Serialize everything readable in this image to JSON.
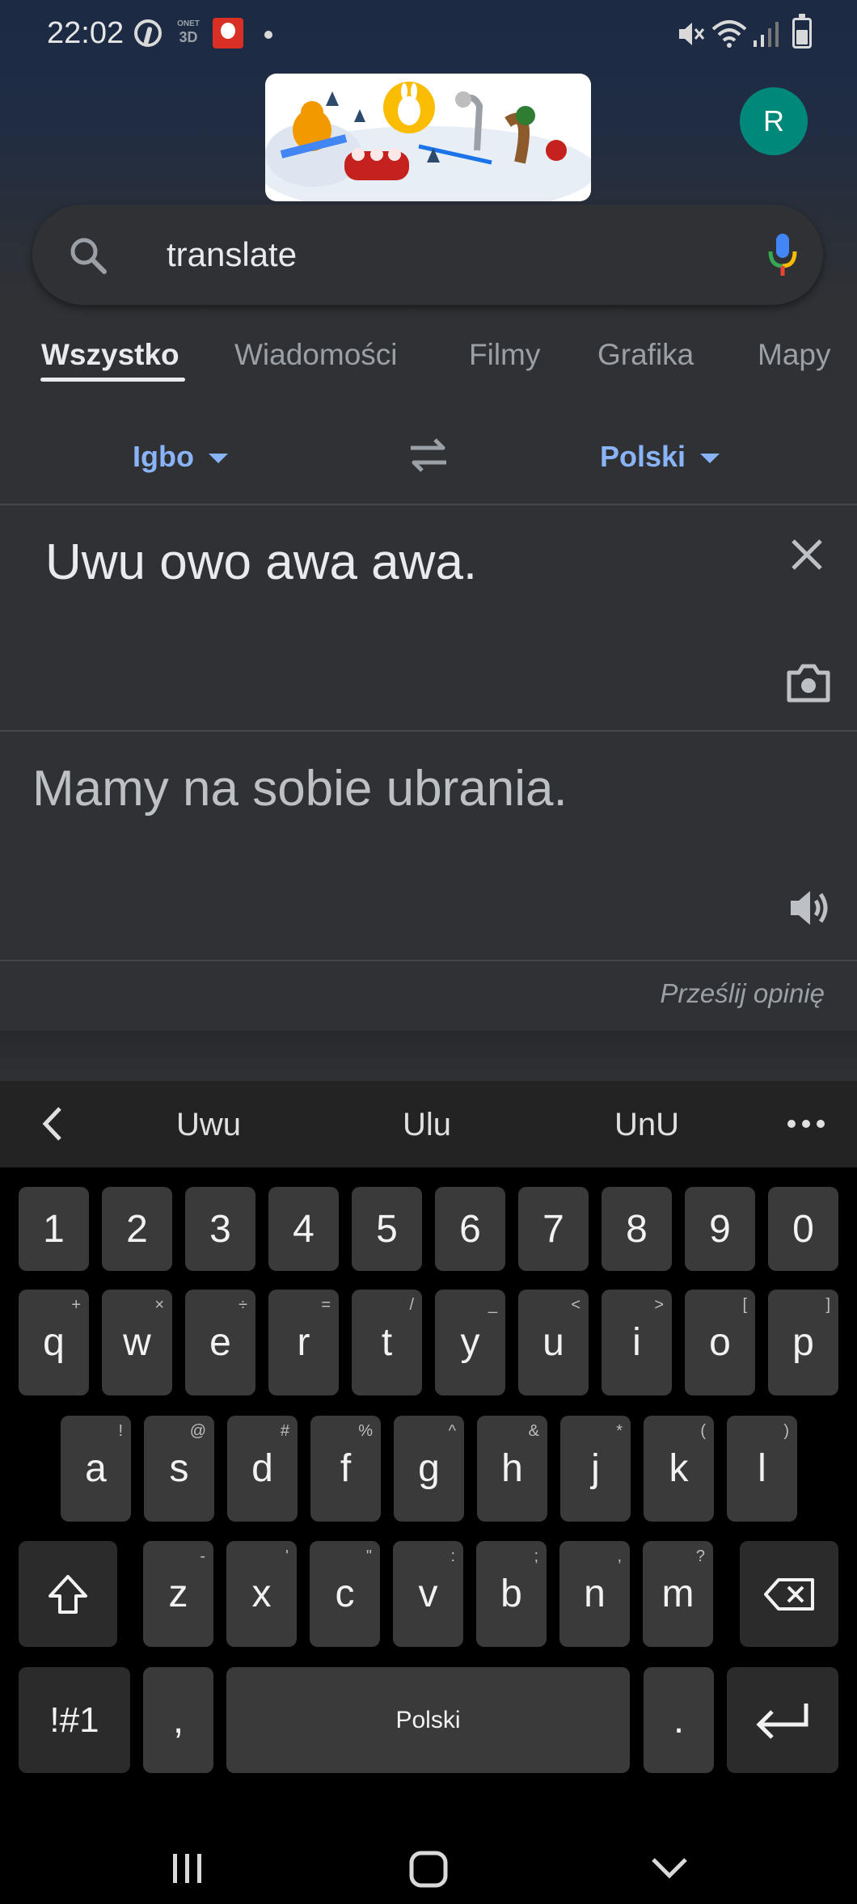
{
  "status_bar": {
    "time": "22:02",
    "onet_top": "ONET",
    "onet_bottom": "3D"
  },
  "avatar": {
    "initial": "R"
  },
  "search": {
    "query": "translate"
  },
  "tabs": [
    "Wszystko",
    "Wiadomości",
    "Filmy",
    "Grafika",
    "Mapy"
  ],
  "translate": {
    "source_language": "Igbo",
    "target_language": "Polski",
    "source_text": "Uwu owo awa awa.",
    "translation_text": "Mamy na sobie ubrania.",
    "feedback_label": "Prześlij opinię"
  },
  "keyboard": {
    "suggestions": [
      "Uwu",
      "Ulu",
      "UnU"
    ],
    "row_numbers": [
      "1",
      "2",
      "3",
      "4",
      "5",
      "6",
      "7",
      "8",
      "9",
      "0"
    ],
    "row1": [
      "q",
      "w",
      "e",
      "r",
      "t",
      "y",
      "u",
      "i",
      "o",
      "p"
    ],
    "row1_sub": [
      "+",
      "×",
      "÷",
      "=",
      "/",
      "_",
      "<",
      ">",
      "[",
      "]"
    ],
    "row2": [
      "a",
      "s",
      "d",
      "f",
      "g",
      "h",
      "j",
      "k",
      "l"
    ],
    "row2_sub": [
      "!",
      "@",
      "#",
      "%",
      "^",
      "&",
      "*",
      "(",
      ")"
    ],
    "row3": [
      "z",
      "x",
      "c",
      "v",
      "b",
      "n",
      "m"
    ],
    "row3_sub": [
      "-",
      "'",
      "\"",
      ":",
      ";",
      ",",
      "?"
    ],
    "symbols_label": "!#1",
    "comma_label": ",",
    "space_label": "Polski",
    "period_label": "."
  },
  "colors": {
    "accent": "#8ab4f8",
    "avatar_bg": "#00897b",
    "background": "#303134"
  }
}
